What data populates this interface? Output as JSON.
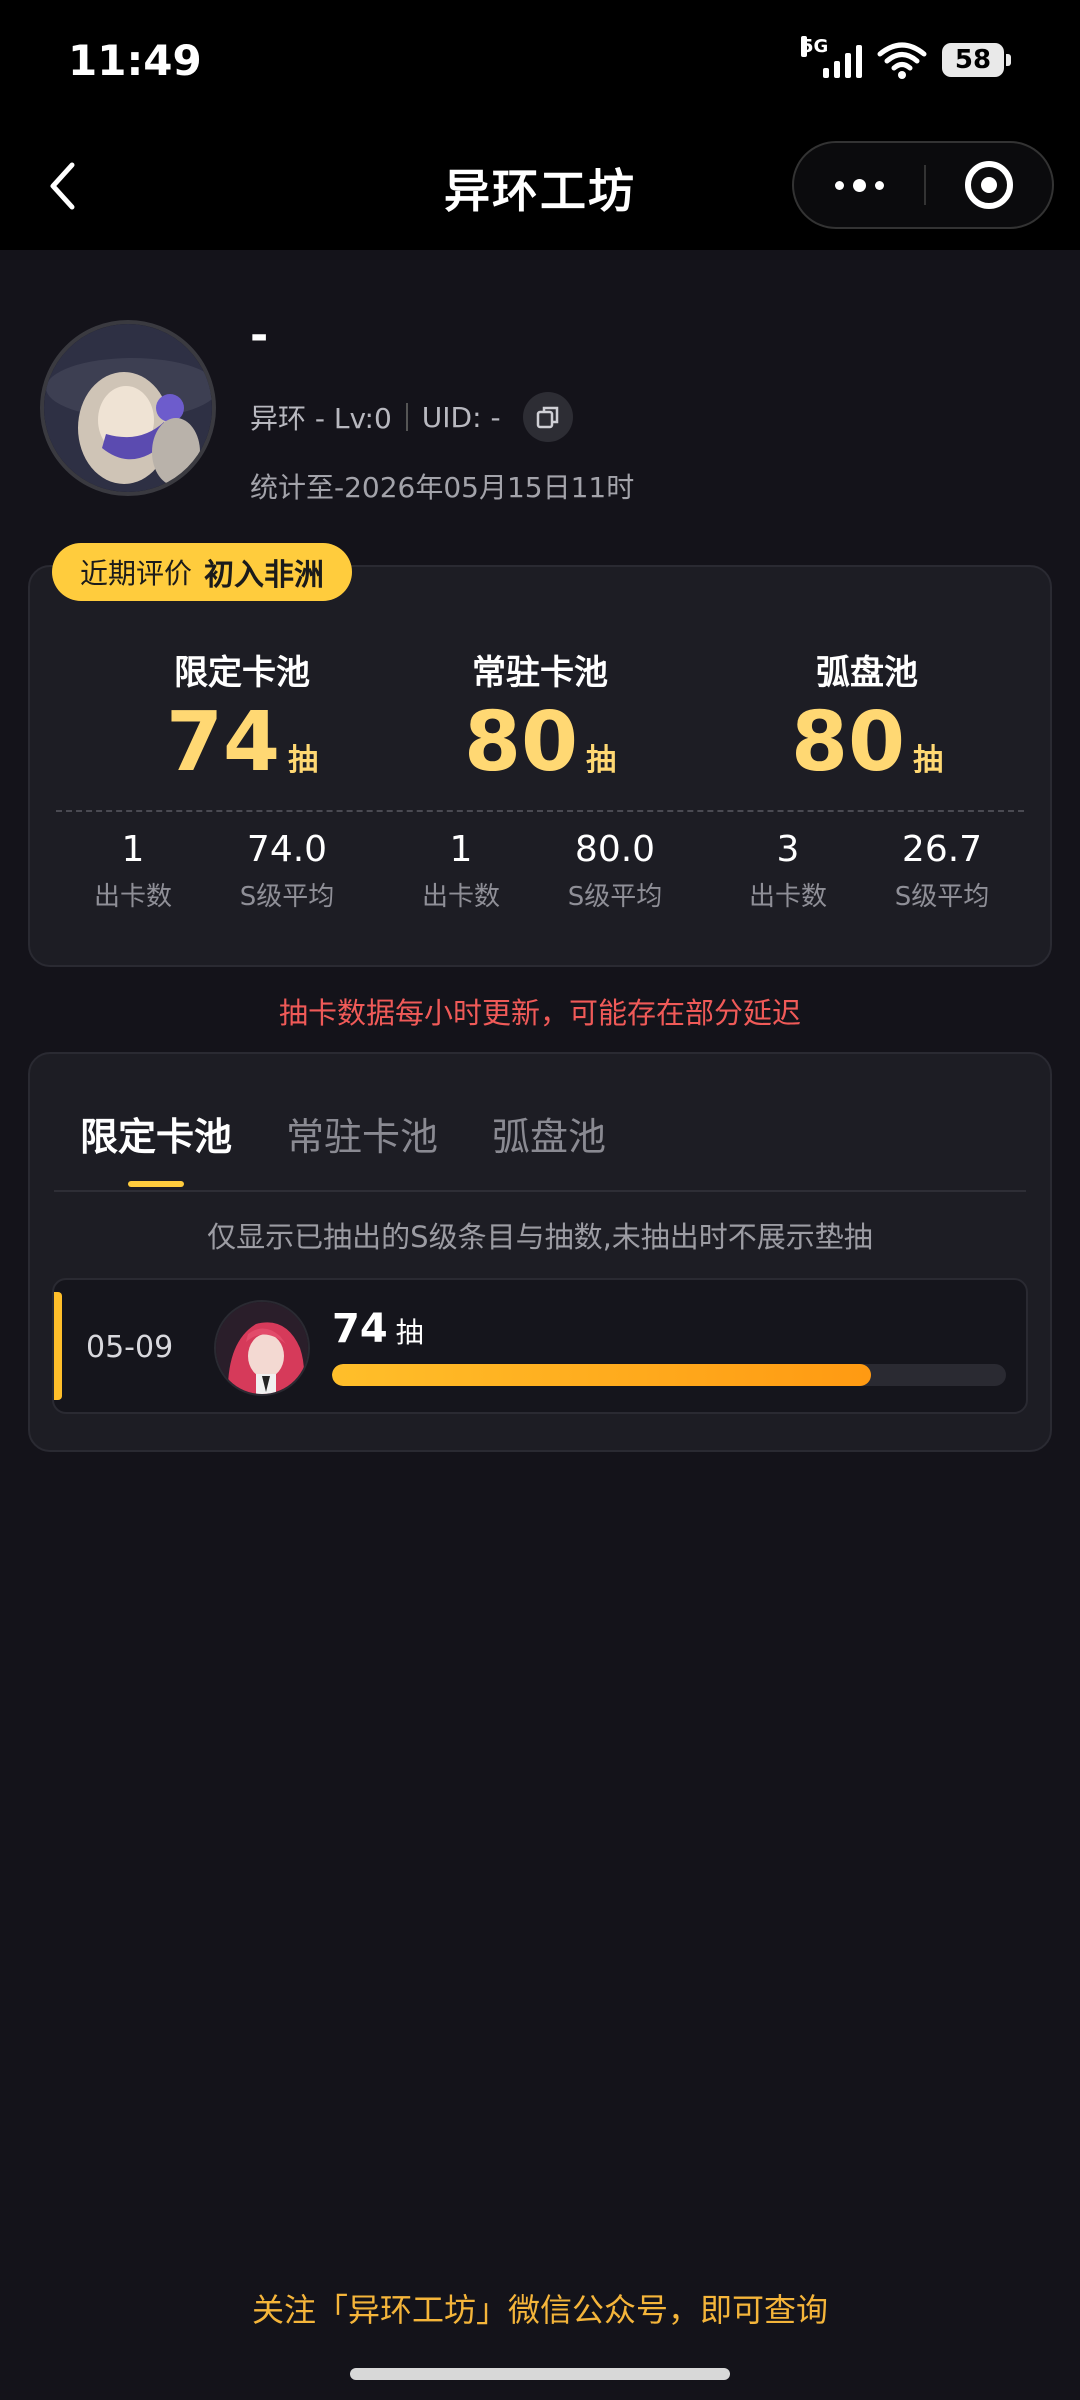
{
  "status_bar": {
    "time": "11:49",
    "network": "5G",
    "battery": "58",
    "icons": [
      "signal-icon",
      "wifi-icon",
      "battery-icon"
    ]
  },
  "nav": {
    "title": "异环工坊",
    "icons": [
      "back-chevron-icon",
      "more-dots-icon",
      "target-icon"
    ]
  },
  "profile": {
    "name": "-",
    "game": "异环 - Lv:0",
    "uid": "UID: -",
    "stat_date": "统计至-2026年05月15日11时"
  },
  "evaluation": {
    "label": "近期评价",
    "value": "初入非洲"
  },
  "pools": [
    {
      "name": "限定卡池",
      "count": "74",
      "unit": "抽",
      "cards_out": "1",
      "cards_out_label": "出卡数",
      "s_avg": "74.0",
      "s_avg_label": "S级平均"
    },
    {
      "name": "常驻卡池",
      "count": "80",
      "unit": "抽",
      "cards_out": "1",
      "cards_out_label": "出卡数",
      "s_avg": "80.0",
      "s_avg_label": "S级平均"
    },
    {
      "name": "弧盘池",
      "count": "80",
      "unit": "抽",
      "cards_out": "3",
      "cards_out_label": "出卡数",
      "s_avg": "26.7",
      "s_avg_label": "S级平均"
    }
  ],
  "notice": "抽卡数据每小时更新，可能存在部分延迟",
  "tabs": [
    "限定卡池",
    "常驻卡池",
    "弧盘池"
  ],
  "active_tab": 0,
  "hint": "仅显示已抽出的S级条目与抽数,未抽出时不展示垫抽",
  "records": [
    {
      "date": "05-09",
      "count": "74",
      "unit": "抽",
      "progress": 0.8
    }
  ],
  "colors": {
    "accent": "#ffcc3d",
    "number": "#ffd873",
    "notice": "#f05a58",
    "footer": "#f5b53a"
  },
  "footer": "关注「异环工坊」微信公众号，即可查询"
}
